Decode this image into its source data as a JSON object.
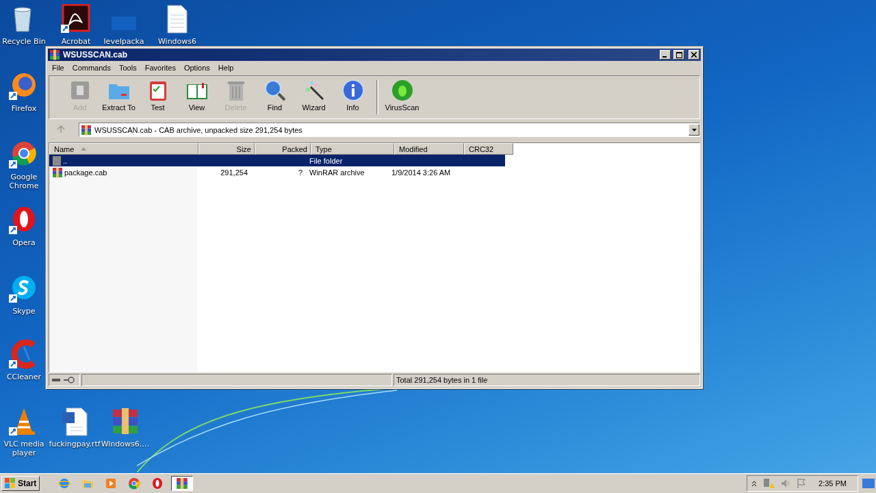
{
  "desktop": {
    "icons": [
      {
        "label": "Recycle Bin",
        "kind": "recycle",
        "shortcut": false
      },
      {
        "label": "Acrobat",
        "kind": "acrobat",
        "shortcut": true
      },
      {
        "label": "levelpacka",
        "kind": "blank",
        "shortcut": false
      },
      {
        "label": "Windows6",
        "kind": "text",
        "shortcut": false
      },
      {
        "label": "Firefox",
        "kind": "firefox",
        "shortcut": true
      },
      {
        "label": "Google Chrome",
        "kind": "chrome",
        "shortcut": true
      },
      {
        "label": "Opera",
        "kind": "opera",
        "shortcut": true
      },
      {
        "label": "Skype",
        "kind": "skype",
        "shortcut": true
      },
      {
        "label": "CCleaner",
        "kind": "ccleaner",
        "shortcut": true
      },
      {
        "label": "VLC media player",
        "kind": "vlc",
        "shortcut": true
      },
      {
        "label": "fuckingpay.rtf",
        "kind": "word",
        "shortcut": false
      },
      {
        "label": "Windows6.…",
        "kind": "winrar",
        "shortcut": false
      }
    ]
  },
  "window": {
    "title": "WSUSSCAN.cab",
    "menu": [
      "File",
      "Commands",
      "Tools",
      "Favorites",
      "Options",
      "Help"
    ],
    "toolbar": [
      {
        "label": "Add",
        "kind": "add",
        "disabled": true
      },
      {
        "label": "Extract To",
        "kind": "extract",
        "disabled": false
      },
      {
        "label": "Test",
        "kind": "test",
        "disabled": false
      },
      {
        "label": "View",
        "kind": "view",
        "disabled": false
      },
      {
        "label": "Delete",
        "kind": "delete",
        "disabled": true
      },
      {
        "label": "Find",
        "kind": "find",
        "disabled": false
      },
      {
        "label": "Wizard",
        "kind": "wizard",
        "disabled": false
      },
      {
        "label": "Info",
        "kind": "info",
        "disabled": false
      },
      {
        "label": "VirusScan",
        "kind": "virus",
        "disabled": false
      }
    ],
    "address": "WSUSSCAN.cab - CAB archive, unpacked size 291,254 bytes",
    "table": {
      "columns": [
        {
          "label": "Name",
          "sorted": true
        },
        {
          "label": "Size",
          "sorted": false
        },
        {
          "label": "Packed",
          "sorted": false
        },
        {
          "label": "Type",
          "sorted": false
        },
        {
          "label": "Modified",
          "sorted": false
        },
        {
          "label": "CRC32",
          "sorted": false
        }
      ],
      "rows": [
        {
          "kind": "folder",
          "selected": true,
          "cells": [
            "..",
            "",
            "",
            "File folder",
            "",
            ""
          ]
        },
        {
          "kind": "archive",
          "selected": false,
          "cells": [
            "package.cab",
            "291,254",
            "?",
            "WinRAR archive",
            "1/9/2014 3:26 AM",
            ""
          ]
        }
      ]
    },
    "status_bar": "Total 291,254 bytes in 1 file"
  },
  "taskbar": {
    "start": "Start",
    "apps": [
      {
        "kind": "ie",
        "active": false
      },
      {
        "kind": "explorer",
        "active": false
      },
      {
        "kind": "media",
        "active": false
      },
      {
        "kind": "chrome",
        "active": false
      },
      {
        "kind": "opera",
        "active": false
      },
      {
        "kind": "winrar",
        "active": true
      }
    ],
    "clock": "2:35 PM"
  }
}
